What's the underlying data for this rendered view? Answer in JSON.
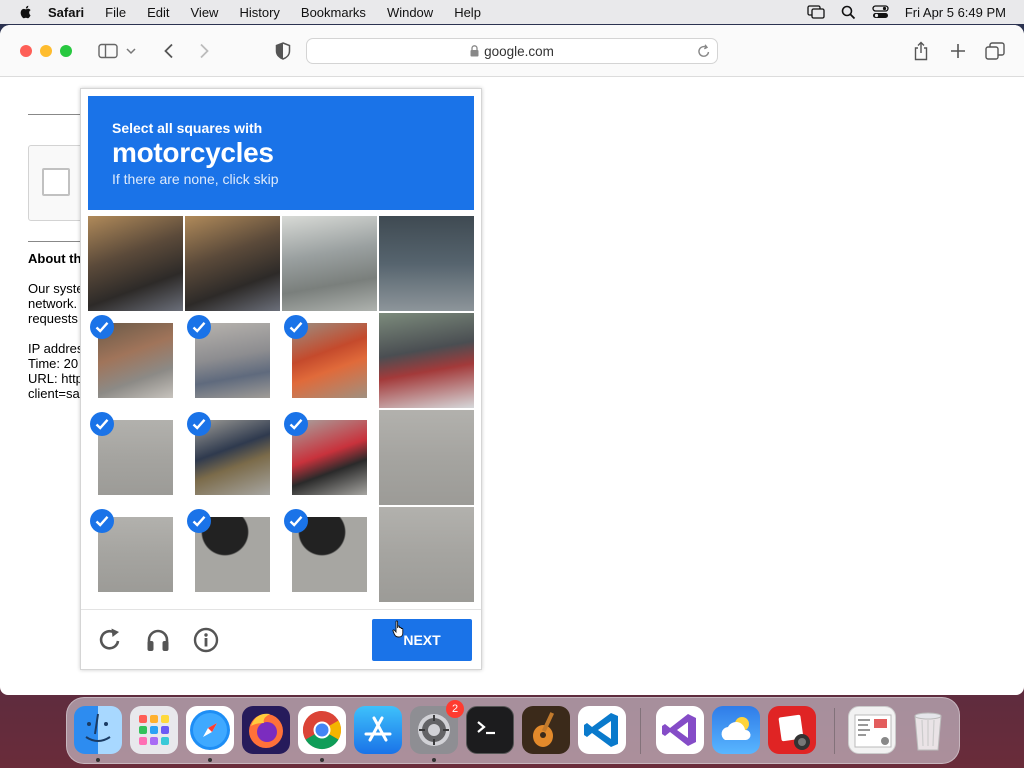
{
  "menubar": {
    "app_name": "Safari",
    "items": [
      "File",
      "Edit",
      "View",
      "History",
      "Bookmarks",
      "Window",
      "Help"
    ],
    "clock": "Fri Apr 5  6:49 PM"
  },
  "browser": {
    "url": "google.com"
  },
  "page": {
    "about_heading": "About th",
    "lines": [
      "Our syste",
      "network.",
      "requests",
      "",
      "IP addres",
      "Time: 20",
      "URL: http",
      "client=sa"
    ]
  },
  "captcha": {
    "instruction": "Select all squares with",
    "target": "motorcycles",
    "hint": "If there are none, click skip",
    "next_label": "NEXT",
    "tiles": [
      {
        "selected": false,
        "scene": "shop"
      },
      {
        "selected": false,
        "scene": "shop"
      },
      {
        "selected": false,
        "scene": "storefront"
      },
      {
        "selected": false,
        "scene": "door"
      },
      {
        "selected": true,
        "scene": "shop-moto"
      },
      {
        "selected": true,
        "scene": "rider"
      },
      {
        "selected": true,
        "scene": "shop-red"
      },
      {
        "selected": false,
        "scene": "street-moto"
      },
      {
        "selected": true,
        "scene": "road"
      },
      {
        "selected": true,
        "scene": "moto-rider"
      },
      {
        "selected": true,
        "scene": "moto-red"
      },
      {
        "selected": false,
        "scene": "road"
      },
      {
        "selected": true,
        "scene": "road"
      },
      {
        "selected": true,
        "scene": "wheel"
      },
      {
        "selected": true,
        "scene": "wheel"
      },
      {
        "selected": false,
        "scene": "road"
      }
    ]
  },
  "dock": {
    "badge_count": "2",
    "apps": [
      "finder-icon",
      "launchpad-icon",
      "safari-icon",
      "firefox-icon",
      "chrome-icon",
      "app-store-icon",
      "system-settings-icon",
      "terminal-icon",
      "garageband-icon",
      "vscode-icon",
      "visual-studio-icon",
      "weather-icon",
      "photo-booth-icon",
      "preview-document-icon",
      "trash-icon"
    ]
  }
}
